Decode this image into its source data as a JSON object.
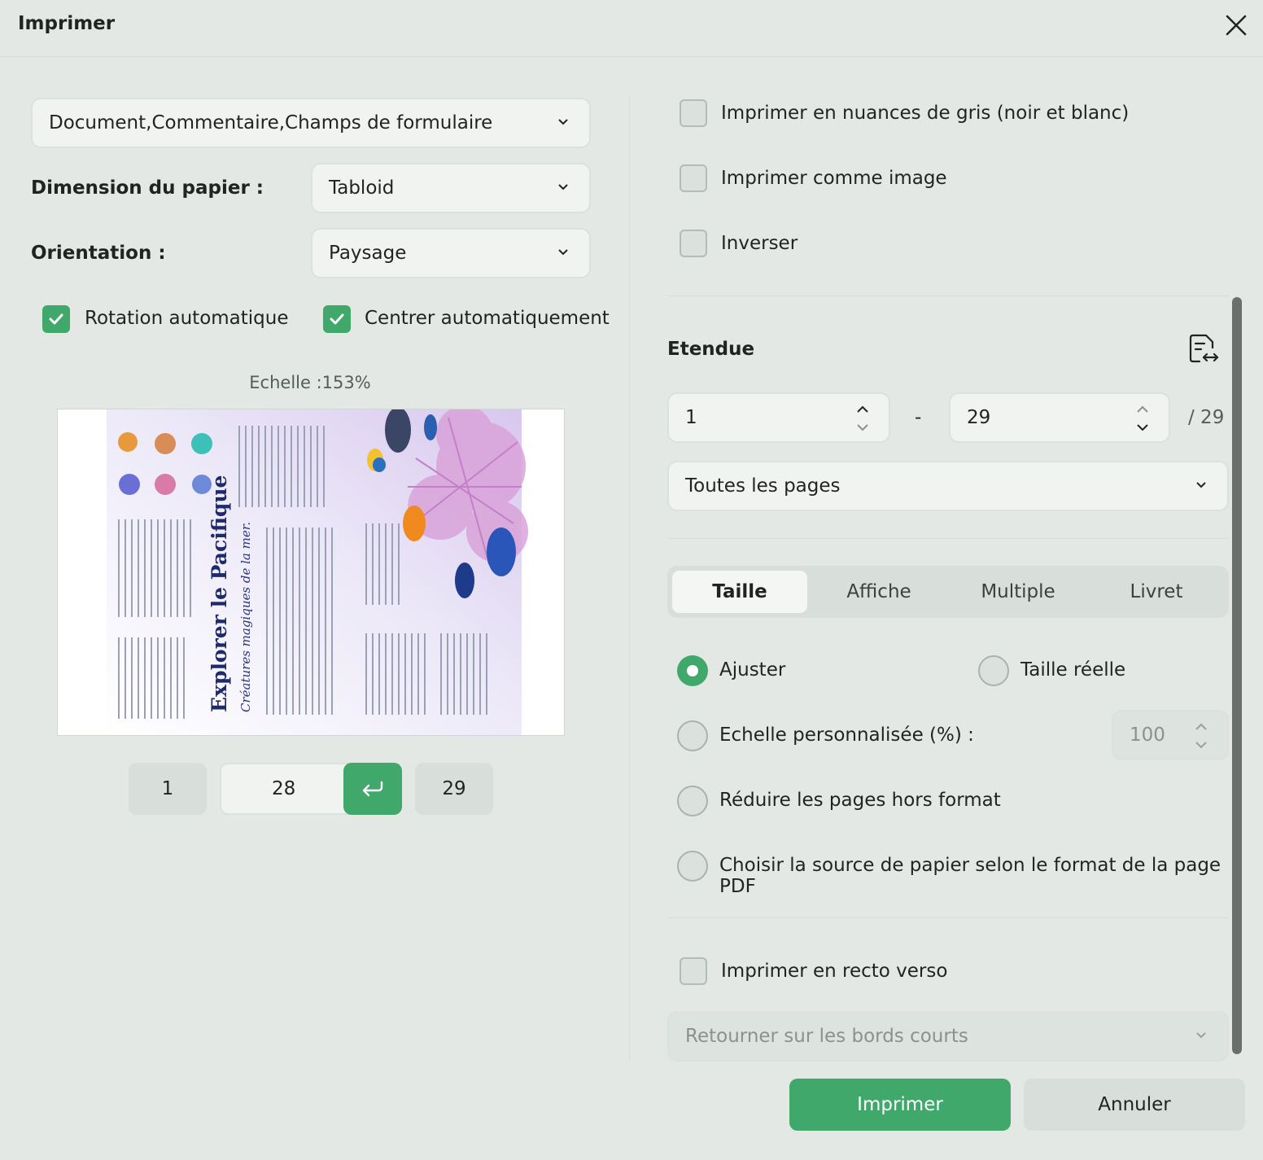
{
  "dialog": {
    "title": "Imprimer"
  },
  "content": {
    "selected": "Document,Commentaire,Champs de formulaire"
  },
  "paper": {
    "label": "Dimension du papier :",
    "selected": "Tabloid"
  },
  "orientation": {
    "label": "Orientation :",
    "selected": "Paysage"
  },
  "options_left": {
    "auto_rotate": "Rotation automatique",
    "auto_center": "Centrer automatiquement"
  },
  "scale_text": "Echelle :153%",
  "preview_doc": {
    "heading": "Explorer le Pacifique",
    "subheading": "Créatures magiques de la mer."
  },
  "pager": {
    "first": "1",
    "current": "28",
    "last": "29"
  },
  "options_right": {
    "grayscale": "Imprimer en nuances de gris (noir et blanc)",
    "as_image": "Imprimer comme image",
    "invert": "Inverser"
  },
  "range": {
    "title": "Etendue",
    "from": "1",
    "to": "29",
    "separator": "-",
    "total": "/ 29",
    "subset": "Toutes les pages"
  },
  "tabs": [
    "Taille",
    "Affiche",
    "Multiple",
    "Livret"
  ],
  "sizing": {
    "fit": "Ajuster",
    "actual": "Taille réelle",
    "custom": "Echelle personnalisée (%) :",
    "custom_value": "100",
    "shrink": "Réduire les pages hors format",
    "source": "Choisir la source de papier selon le format de la page PDF"
  },
  "duplex": {
    "label": "Imprimer en recto verso",
    "flip": "Retourner sur les bords courts"
  },
  "actions": {
    "print": "Imprimer",
    "cancel": "Annuler"
  },
  "colors": {
    "accent": "#40a86b",
    "background": "#e3e8e4"
  }
}
